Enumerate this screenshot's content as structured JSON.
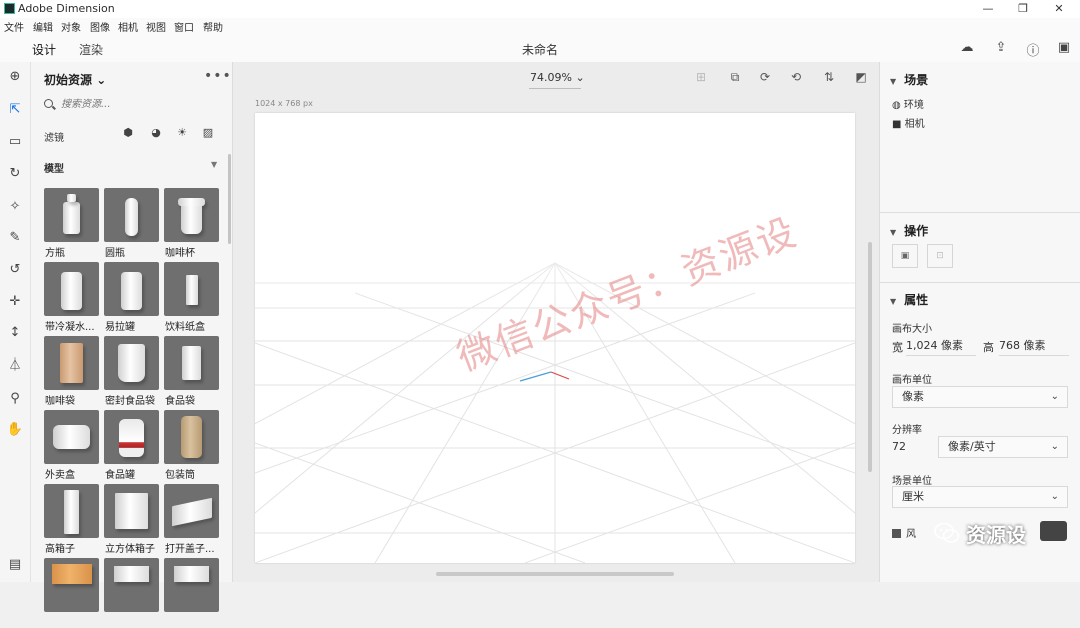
{
  "window": {
    "title": "Adobe Dimension",
    "min": "—",
    "restore": "❐",
    "close": "✕"
  },
  "menu": [
    "文件",
    "编辑",
    "对象",
    "图像",
    "相机",
    "视图",
    "窗口",
    "帮助"
  ],
  "modes": {
    "design": "设计",
    "render": "渲染"
  },
  "document": {
    "name": "未命名"
  },
  "tools": [
    "plus-circle",
    "select",
    "rectangle-select",
    "rotate",
    "magic-wand",
    "eyedropper",
    "orbit",
    "pan-move",
    "dolly",
    "horizon",
    "zoom",
    "hand"
  ],
  "assets": {
    "title": "初始资源",
    "title_chevron": "⌄",
    "more": "•••",
    "search_placeholder": "搜索资源...",
    "filter_label": "滤镜",
    "section": "模型",
    "items": [
      {
        "label": "方瓶"
      },
      {
        "label": "圆瓶"
      },
      {
        "label": "咖啡杯"
      },
      {
        "label": "带冷凝水..."
      },
      {
        "label": "易拉罐"
      },
      {
        "label": "饮料纸盒"
      },
      {
        "label": "咖啡袋"
      },
      {
        "label": "密封食品袋"
      },
      {
        "label": "食品袋"
      },
      {
        "label": "外卖盒"
      },
      {
        "label": "食品罐"
      },
      {
        "label": "包装筒"
      },
      {
        "label": "高箱子"
      },
      {
        "label": "立方体箱子"
      },
      {
        "label": "打开盖子..."
      }
    ]
  },
  "viewport": {
    "zoom": "74.09%",
    "zoom_chevron": "⌄",
    "canvas_size_label": "1024 x 768 px"
  },
  "right_panel": {
    "scene": {
      "title": "场景",
      "items": [
        {
          "icon": "globe-icon",
          "label": "环境"
        },
        {
          "icon": "camera-icon",
          "label": "相机"
        }
      ]
    },
    "actions": {
      "title": "操作"
    },
    "properties": {
      "title": "属性",
      "canvas_size_label": "画布大小",
      "width_label": "宽",
      "width_value": "1,024 像素",
      "height_label": "高",
      "height_value": "768 像素",
      "canvas_unit_label": "画布单位",
      "canvas_unit_value": "像素",
      "resolution_label": "分辨率",
      "resolution_value": "72",
      "resolution_unit": "像素/英寸",
      "scene_unit_label": "场景单位",
      "scene_unit_value": "厘米",
      "checkbox_label": "风"
    }
  },
  "watermark": {
    "text": "微信公众号：资源设",
    "badge_text": "资源设"
  },
  "colors": {
    "accent": "#1473e6",
    "tile_bg": "#6f6f6f",
    "watermark": "#e48282"
  }
}
